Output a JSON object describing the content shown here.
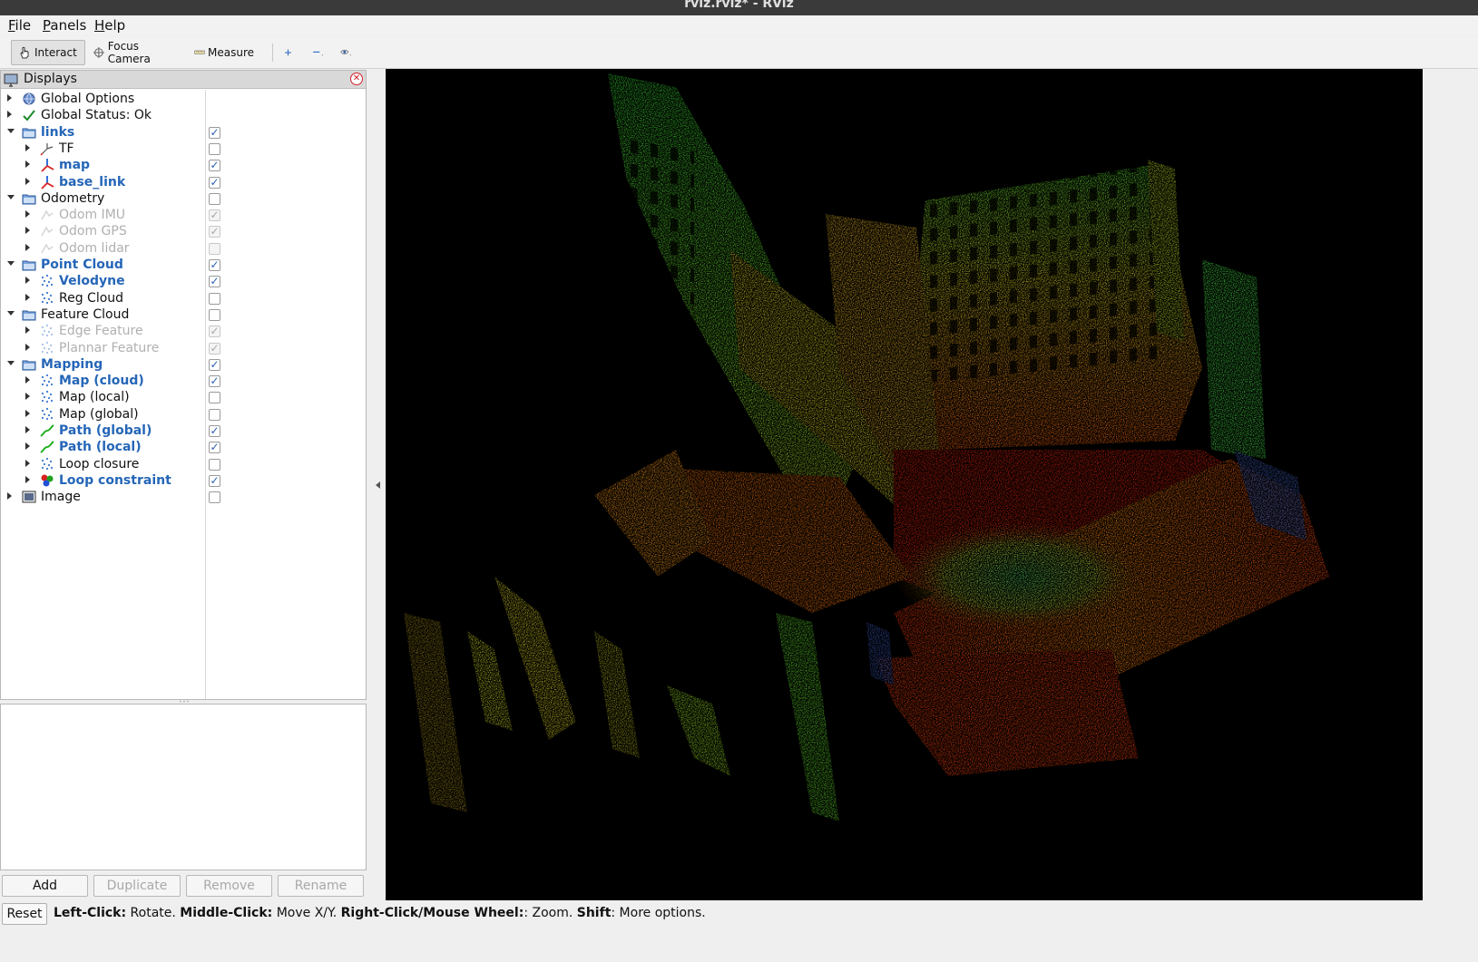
{
  "window": {
    "title": "rviz.rviz* - RViz"
  },
  "menu": [
    {
      "underline": "F",
      "rest": "ile"
    },
    {
      "underline": "P",
      "rest": "anels"
    },
    {
      "underline": "H",
      "rest": "elp"
    }
  ],
  "toolbar": {
    "interact": "Interact",
    "focus_camera": "Focus Camera",
    "measure": "Measure"
  },
  "displays": {
    "title": "Displays",
    "items": [
      {
        "label": "Global Options",
        "depth": 0,
        "expander": "right",
        "icon": "globe-icon",
        "style": "normal",
        "checkbox": "none"
      },
      {
        "label": "Global Status: Ok",
        "depth": 0,
        "expander": "right",
        "icon": "check-icon",
        "style": "normal",
        "checkbox": "none"
      },
      {
        "label": "links",
        "depth": 0,
        "expander": "down",
        "icon": "folder-icon",
        "style": "bold",
        "checkbox": "checked"
      },
      {
        "label": "TF",
        "depth": 1,
        "expander": "right",
        "icon": "tf-icon",
        "style": "normal",
        "checkbox": "unchecked"
      },
      {
        "label": "map",
        "depth": 1,
        "expander": "right",
        "icon": "axes-icon",
        "style": "bold",
        "checkbox": "checked"
      },
      {
        "label": "base_link",
        "depth": 1,
        "expander": "right",
        "icon": "axes-icon",
        "style": "bold",
        "checkbox": "checked"
      },
      {
        "label": "Odometry",
        "depth": 0,
        "expander": "down",
        "icon": "folder-icon",
        "style": "normal",
        "checkbox": "unchecked"
      },
      {
        "label": "Odom IMU",
        "depth": 1,
        "expander": "right",
        "icon": "odometry-icon",
        "style": "disabled",
        "checkbox": "checked-disabled"
      },
      {
        "label": "Odom GPS",
        "depth": 1,
        "expander": "right",
        "icon": "odometry-icon",
        "style": "disabled",
        "checkbox": "checked-disabled"
      },
      {
        "label": "Odom lidar",
        "depth": 1,
        "expander": "right",
        "icon": "odometry-icon",
        "style": "disabled",
        "checkbox": "unchecked-disabled"
      },
      {
        "label": "Point Cloud",
        "depth": 0,
        "expander": "down",
        "icon": "folder-icon",
        "style": "bold",
        "checkbox": "checked"
      },
      {
        "label": "Velodyne",
        "depth": 1,
        "expander": "right",
        "icon": "pointcloud-icon",
        "style": "bold",
        "checkbox": "checked"
      },
      {
        "label": "Reg Cloud",
        "depth": 1,
        "expander": "right",
        "icon": "pointcloud-icon",
        "style": "normal",
        "checkbox": "unchecked"
      },
      {
        "label": "Feature Cloud",
        "depth": 0,
        "expander": "down",
        "icon": "folder-icon",
        "style": "normal",
        "checkbox": "unchecked"
      },
      {
        "label": "Edge Feature",
        "depth": 1,
        "expander": "right",
        "icon": "pointcloud-icon",
        "style": "disabled",
        "checkbox": "checked-disabled"
      },
      {
        "label": "Plannar Feature",
        "depth": 1,
        "expander": "right",
        "icon": "pointcloud-icon",
        "style": "disabled",
        "checkbox": "checked-disabled"
      },
      {
        "label": "Mapping",
        "depth": 0,
        "expander": "down",
        "icon": "folder-icon",
        "style": "bold",
        "checkbox": "checked"
      },
      {
        "label": "Map (cloud)",
        "depth": 1,
        "expander": "right",
        "icon": "pointcloud-icon",
        "style": "bold",
        "checkbox": "checked"
      },
      {
        "label": "Map (local)",
        "depth": 1,
        "expander": "right",
        "icon": "pointcloud-icon",
        "style": "normal",
        "checkbox": "unchecked"
      },
      {
        "label": "Map (global)",
        "depth": 1,
        "expander": "right",
        "icon": "pointcloud-icon",
        "style": "normal",
        "checkbox": "unchecked"
      },
      {
        "label": "Path (global)",
        "depth": 1,
        "expander": "right",
        "icon": "path-icon",
        "style": "bold",
        "checkbox": "checked"
      },
      {
        "label": "Path (local)",
        "depth": 1,
        "expander": "right",
        "icon": "path-icon",
        "style": "bold",
        "checkbox": "checked"
      },
      {
        "label": "Loop closure",
        "depth": 1,
        "expander": "right",
        "icon": "pointcloud-icon",
        "style": "normal",
        "checkbox": "unchecked"
      },
      {
        "label": "Loop constraint",
        "depth": 1,
        "expander": "right",
        "icon": "markers-icon",
        "style": "bold",
        "checkbox": "checked"
      },
      {
        "label": "Image",
        "depth": 0,
        "expander": "right",
        "icon": "image-icon",
        "style": "normal",
        "checkbox": "unchecked"
      }
    ]
  },
  "panel_buttons": {
    "add": "Add",
    "duplicate": "Duplicate",
    "remove": "Remove",
    "rename": "Rename"
  },
  "status": {
    "reset": "Reset",
    "hints": [
      {
        "key": "Left-Click:",
        "text": " Rotate. "
      },
      {
        "key": "Middle-Click:",
        "text": " Move X/Y. "
      },
      {
        "key": "Right-Click/Mouse Wheel:",
        "text": ": Zoom. "
      },
      {
        "key": "Shift",
        "text": ": More options."
      }
    ]
  },
  "colors": {
    "accent_blue": "#2566b8",
    "point_low": "#e02000",
    "point_mid": "#f0a000",
    "point_high": "#30d020",
    "viewport_bg": "#000000"
  }
}
